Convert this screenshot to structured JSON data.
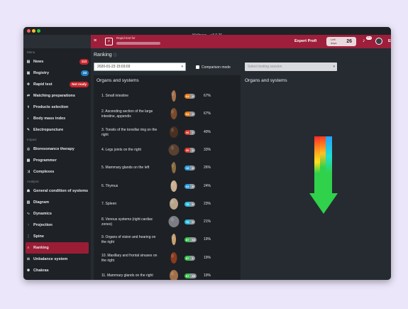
{
  "window": {
    "title": "Wellness – v3.0.26"
  },
  "colors": {
    "accent": "#9e1f3b",
    "active_item": "#9a1d35",
    "badge_red": "#c7262c",
    "badge_blue": "#1f7ec4",
    "arrow_green": "#2fd24a"
  },
  "sidebar": {
    "sections": [
      {
        "label": "Menu",
        "items": [
          {
            "label": "News",
            "icon": "newspaper-icon",
            "badge": "113",
            "badge_color": "red"
          },
          {
            "label": "Registry",
            "icon": "registry-icon",
            "badge": "24",
            "badge_color": "blue"
          },
          {
            "label": "Rapid test",
            "icon": "rapid-test-icon",
            "badge": "Not ready",
            "badge_color": "red"
          },
          {
            "label": "Matching preparations",
            "icon": "matching-icon"
          },
          {
            "label": "Products selection",
            "icon": "products-icon"
          },
          {
            "label": "Body mass index",
            "icon": "scale-icon"
          },
          {
            "label": "Electropuncture",
            "icon": "pen-icon"
          }
        ]
      },
      {
        "label": "Impact",
        "items": [
          {
            "label": "Bioresonance therapy",
            "icon": "target-icon"
          },
          {
            "label": "Programmer",
            "icon": "programmer-icon"
          },
          {
            "label": "Complexes",
            "icon": "shuffle-icon"
          }
        ]
      },
      {
        "label": "Analysis",
        "items": [
          {
            "label": "General condition of systems",
            "icon": "person-icon"
          },
          {
            "label": "Diagram",
            "icon": "bar-chart-icon"
          },
          {
            "label": "Dynamics",
            "icon": "line-chart-icon"
          },
          {
            "label": "Projection",
            "icon": "projection-icon"
          },
          {
            "label": "Spine",
            "icon": "spine-icon"
          },
          {
            "label": "Ranking",
            "icon": "ranking-icon",
            "active": true
          },
          {
            "label": "Unbalance system",
            "icon": "unbalance-icon"
          },
          {
            "label": "Chakras",
            "icon": "chakra-icon"
          }
        ]
      }
    ]
  },
  "topbar": {
    "patient_label": "Rapid test for",
    "mode": "Expert Profi",
    "left_days_label": "Left days",
    "left_days": "26",
    "notif_count": "114",
    "language": "EN"
  },
  "main": {
    "page_title": "Ranking",
    "date_value": "2020-01-23 15:03:03",
    "comparison_label": "Comparison mode",
    "session_placeholder": "Select testing session",
    "left_panel_title": "Organs and systems",
    "right_panel_title": "Organs and systems",
    "organs": [
      {
        "rank": "1. Small intestine",
        "a": "64",
        "b": "4",
        "a_color": "#e07a1e",
        "pct": "67%"
      },
      {
        "rank": "2. Ascending section of the large intestine, appendix",
        "a": "64",
        "b": "4",
        "a_color": "#e07a1e",
        "pct": "67%"
      },
      {
        "rank": "3. Tonsils of the tonsillar ring on the right",
        "a": "36",
        "b": "7",
        "a_color": "#d63a2a",
        "pct": "40%"
      },
      {
        "rank": "4. Legs joints on the right",
        "a": "30",
        "b": "2",
        "a_color": "#d63a2a",
        "pct": "33%"
      },
      {
        "rank": "5. Mammary glands on the left",
        "a": "16",
        "b": "8",
        "a_color": "#2c9ad8",
        "pct": "26%"
      },
      {
        "rank": "6. Thymus",
        "a": "64",
        "b": "8",
        "a_color": "#2c9ad8",
        "pct": "24%"
      },
      {
        "rank": "7. Spleen",
        "a": "76",
        "b": "8",
        "a_color": "#2cb8d6",
        "pct": "23%"
      },
      {
        "rank": "8. Venous systems (right cardiac zones)",
        "a": "76",
        "b": "3",
        "a_color": "#2cb8d6",
        "pct": "21%"
      },
      {
        "rank": "9. Organs of vision and hearing on the right",
        "a": "87",
        "b": "13",
        "a_color": "#3bbd4d",
        "pct": "19%"
      },
      {
        "rank": "10. Maxillary and frontal sinuses on the right",
        "a": "87",
        "b": "1",
        "a_color": "#3bbd4d",
        "pct": "19%"
      },
      {
        "rank": "11. Mammary glands on the right",
        "a": "87",
        "b": "16",
        "a_color": "#3bbd4d",
        "pct": "19%"
      }
    ]
  }
}
